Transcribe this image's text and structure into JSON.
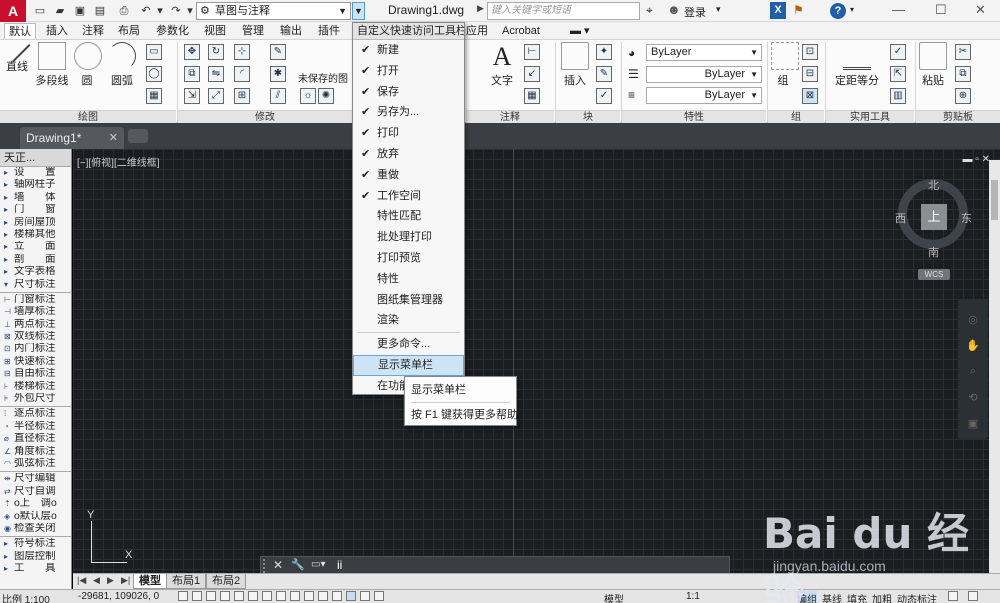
{
  "titlebar": {
    "logo": "A",
    "workspace": "草图与注释",
    "document_title": "Drawing1.dwg",
    "search_placeholder": "键入关键字或短语",
    "login": "登录",
    "exchange": "X",
    "help": "?"
  },
  "ribbon_tabs": [
    "默认",
    "插入",
    "注释",
    "布局",
    "参数化",
    "视图",
    "管理",
    "输出",
    "插件",
    "应用",
    "Acrobat"
  ],
  "ribbon": {
    "draw": {
      "line": "直线",
      "polyline": "多段线",
      "circle": "圆",
      "arc": "圆弧",
      "panel_label": "绘图"
    },
    "modify": {
      "panel_label": "修改",
      "unsaved_layer": "未保存的图"
    },
    "annotation": {
      "text": "文字",
      "panel_label": "注释"
    },
    "block": {
      "insert": "插入",
      "panel_label": "块"
    },
    "properties": {
      "color": "ByLayer",
      "linetype": "ByLayer",
      "lineweight": "ByLayer",
      "panel_label": "特性"
    },
    "groups": {
      "group": "组",
      "panel_label": "组"
    },
    "utilities": {
      "measure": "定距等分",
      "panel_label": "实用工具"
    },
    "clipboard": {
      "paste": "粘贴",
      "panel_label": "剪贴板"
    }
  },
  "doc_tabs": {
    "active": "Drawing1*"
  },
  "palette": {
    "title": "天正...",
    "items": [
      "设　　置",
      "轴网柱子",
      "墙　　体",
      "门　　窗",
      "房间屋顶",
      "楼梯其他",
      "立　　面",
      "剖　　面",
      "文字表格",
      "尺寸标注"
    ],
    "dim_items": [
      "门窗标注",
      "墙厚标注",
      "两点标注",
      "双线标注",
      "内门标注",
      "快速标注",
      "自由标注",
      "楼梯标注",
      "外包尺寸"
    ],
    "arc_items": [
      "逐点标注",
      "半径标注",
      "直径标注",
      "角度标注",
      "弧弦标注"
    ],
    "edit_items": [
      "尺寸编辑",
      "尺寸自调",
      "o上　调o",
      "o默认层o",
      "检查关闭"
    ],
    "other_items": [
      "符号标注",
      "图层控制",
      "工　　具"
    ]
  },
  "canvas": {
    "viewport_label": "[−][俯视][二维线框]",
    "viewcube": {
      "top": "上",
      "north": "北",
      "south": "南",
      "east": "东",
      "west": "西",
      "wcs": "WCS"
    },
    "ucs": {
      "x": "X",
      "y": "Y"
    }
  },
  "qa_menu": {
    "title": "自定义快速访问工具栏",
    "items": [
      {
        "label": "新建",
        "checked": true
      },
      {
        "label": "打开",
        "checked": true
      },
      {
        "label": "保存",
        "checked": true
      },
      {
        "label": "另存为...",
        "checked": true
      },
      {
        "label": "打印",
        "checked": true
      },
      {
        "label": "放弃",
        "checked": true
      },
      {
        "label": "重做",
        "checked": true
      },
      {
        "label": "工作空间",
        "checked": true
      },
      {
        "label": "特性匹配",
        "checked": false
      },
      {
        "label": "批处理打印",
        "checked": false
      },
      {
        "label": "打印预览",
        "checked": false
      },
      {
        "label": "特性",
        "checked": false
      },
      {
        "label": "图纸集管理器",
        "checked": false
      },
      {
        "label": "渲染",
        "checked": false
      }
    ],
    "more_commands": "更多命令...",
    "show_menubar": "显示菜单栏",
    "show_below_ribbon": "在功能"
  },
  "tooltip": {
    "title": "显示菜单栏",
    "help": "按 F1 键获得更多帮助"
  },
  "command_line": {
    "input": "ii"
  },
  "layout_tabs": [
    "模型",
    "布局1",
    "布局2"
  ],
  "statusbar": {
    "scale": "比例 1:100",
    "coords": "-29681, 109026, 0",
    "model": "模型",
    "annotation_scale": "1:1",
    "toggles": [
      "编组",
      "基线",
      "填充",
      "加粗",
      "动态标注"
    ]
  },
  "watermark": {
    "logo": "Bai du 经验",
    "url": "jingyan.baidu.com"
  }
}
